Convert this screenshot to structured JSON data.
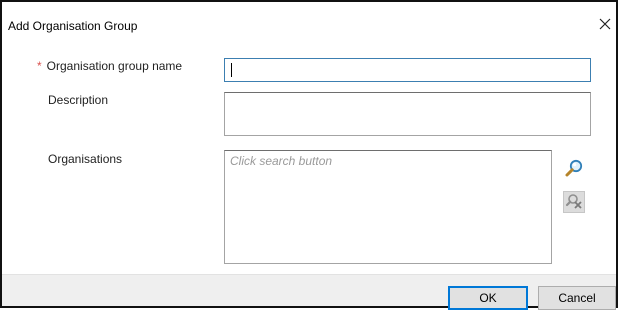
{
  "dialog": {
    "title": "Add Organisation Group",
    "close_symbol": "✕"
  },
  "form": {
    "name_label": "Organisation group name",
    "name_required_marker": "*",
    "name_value": "",
    "description_label": "Description",
    "description_value": "",
    "organisations_label": "Organisations",
    "organisations_placeholder": "Click search button"
  },
  "icons": {
    "search": "search-icon",
    "remove": "remove-icon",
    "close": "close-icon"
  },
  "footer": {
    "ok_label": "OK",
    "cancel_label": "Cancel"
  },
  "colors": {
    "required": "#d9534f",
    "focus_border": "#3c7fb1",
    "default_button_border": "#0078d7"
  }
}
